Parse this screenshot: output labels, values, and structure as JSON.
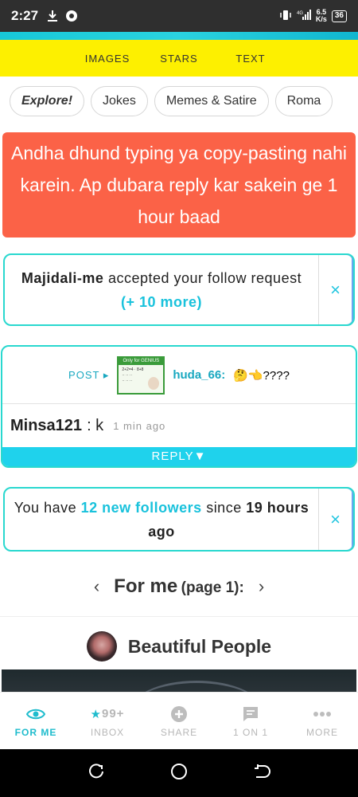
{
  "status_bar": {
    "time": "2:27",
    "speed": "6.5",
    "speed_unit": "K/s",
    "battery": "36",
    "network": "4G"
  },
  "top_nav": {
    "items": [
      "IMAGES",
      "STARS",
      "TEXT"
    ]
  },
  "categories": [
    "Explore!",
    "Jokes",
    "Memes & Satire",
    "Roma"
  ],
  "warning": {
    "text": "Andha dhund typing ya copy-pasting nahi karein. Ap dubara reply kar sakein ge 1 hour baad"
  },
  "follow_request": {
    "user": "Majidali-me",
    "text": "accepted your follow request",
    "more": "(+ 10 more)",
    "close": "×"
  },
  "activity": {
    "post_label": "POST ▸",
    "thumb_caption": "Only for GENIUS",
    "author": "huda_66:",
    "post_text": "🤔👈????",
    "commenter": "Minsa121",
    "comment": ": k",
    "time": "1 min ago",
    "reply_label": "REPLY▼"
  },
  "followers_notice": {
    "prefix": "You have",
    "count_text": "12 new followers",
    "middle": "since",
    "hours": "19",
    "suffix": "hours ago",
    "close": "×"
  },
  "feed": {
    "title": "For me",
    "page": "(page 1):",
    "prev": "‹",
    "next": "›"
  },
  "group": {
    "name": "Beautiful People"
  },
  "bottom_nav": [
    {
      "label": "FOR ME",
      "icon": "eye-icon",
      "active": true
    },
    {
      "label": "INBOX",
      "icon": "star-icon",
      "badge": "99+"
    },
    {
      "label": "SHARE",
      "icon": "plus-circle-icon"
    },
    {
      "label": "1 ON 1",
      "icon": "chat-icon"
    },
    {
      "label": "MORE",
      "icon": "more-dots-icon"
    }
  ],
  "colors": {
    "accent": "#19c2dc",
    "warning": "#fb6247",
    "yellow": "#fdf000"
  }
}
